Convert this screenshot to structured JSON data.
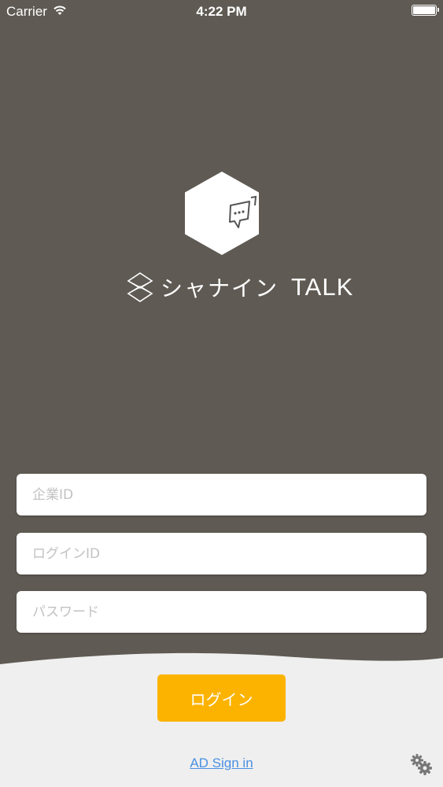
{
  "status": {
    "carrier": "Carrier",
    "time": "4:22 PM"
  },
  "brand": {
    "jp_name": "シャナイン",
    "talk": "TALK"
  },
  "form": {
    "company_id_placeholder": "企業ID",
    "login_id_placeholder": "ログインID",
    "password_placeholder": "パスワード",
    "company_id_value": "",
    "login_id_value": "",
    "password_value": ""
  },
  "actions": {
    "login_label": "ログイン",
    "ad_sign_in": "AD Sign in"
  },
  "colors": {
    "background_top": "#5f5a53",
    "background_bottom": "#efefef",
    "accent": "#fbb300",
    "link": "#4a90e2"
  },
  "icons": [
    "wifi-icon",
    "battery-icon",
    "app-logo-icon",
    "brand-mark-icon",
    "settings-icon"
  ]
}
